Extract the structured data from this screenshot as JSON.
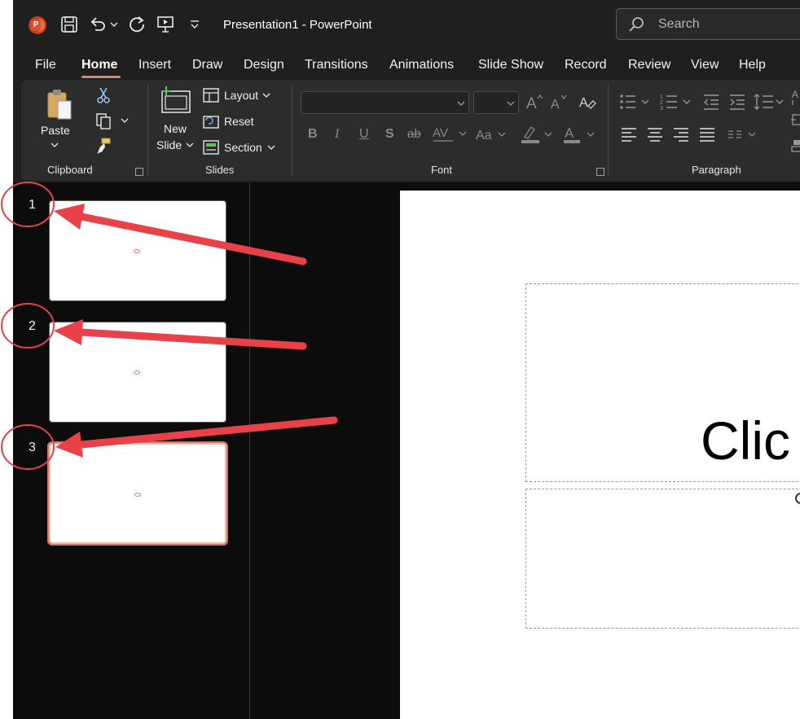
{
  "app": {
    "title": "Presentation1  -  PowerPoint",
    "logo_letter": "P",
    "search_placeholder": "Search"
  },
  "menu": {
    "tabs": [
      "File",
      "Home",
      "Insert",
      "Draw",
      "Design",
      "Transitions",
      "Animations",
      "Slide Show",
      "Record",
      "Review",
      "View",
      "Help"
    ],
    "active": "Home"
  },
  "ribbon": {
    "clipboard": {
      "paste": "Paste",
      "group_label": "Clipboard"
    },
    "slides": {
      "new_slide_line1": "New",
      "new_slide_line2": "Slide",
      "layout": "Layout",
      "reset": "Reset",
      "section": "Section",
      "group_label": "Slides"
    },
    "font": {
      "group_label": "Font",
      "font_name": "",
      "font_size": ""
    },
    "paragraph": {
      "group_label": "Paragraph"
    }
  },
  "thumbnails": [
    {
      "number": "1",
      "selected": false
    },
    {
      "number": "2",
      "selected": false
    },
    {
      "number": "3",
      "selected": true
    }
  ],
  "slide": {
    "title_placeholder": "Clic"
  },
  "colors": {
    "accent": "#e0856b",
    "annotation_red": "#e8414a",
    "background": "#1f1f1f"
  }
}
